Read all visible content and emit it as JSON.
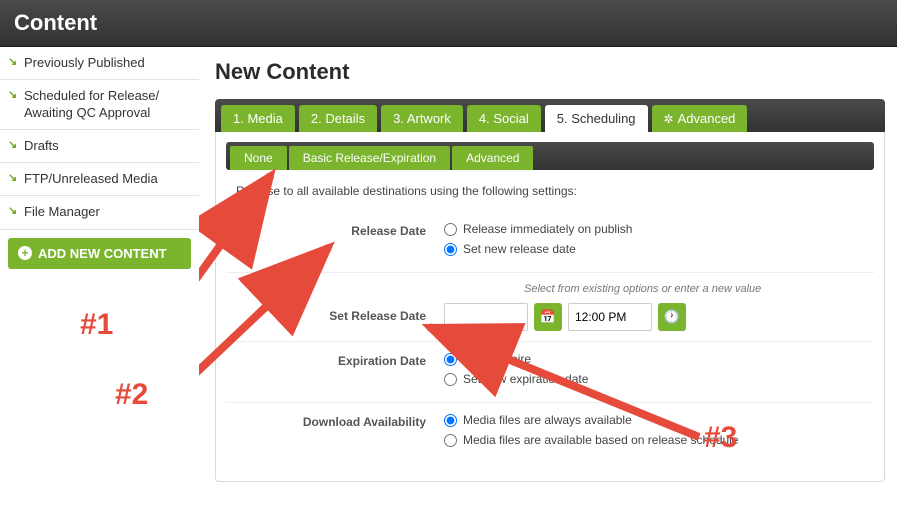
{
  "header": {
    "title": "Content"
  },
  "sidebar": {
    "items": [
      {
        "label": "Previously Published"
      },
      {
        "label": "Scheduled for Release/ Awaiting QC Approval"
      },
      {
        "label": "Drafts"
      },
      {
        "label": "FTP/Unreleased Media"
      },
      {
        "label": "File Manager"
      }
    ],
    "add_button": "ADD NEW CONTENT"
  },
  "page": {
    "title": "New Content"
  },
  "tabs": [
    {
      "label": "1. Media"
    },
    {
      "label": "2. Details"
    },
    {
      "label": "3. Artwork"
    },
    {
      "label": "4. Social"
    },
    {
      "label": "5. Scheduling"
    },
    {
      "label": "Advanced"
    }
  ],
  "subtabs": [
    {
      "label": "None"
    },
    {
      "label": "Basic Release/Expiration"
    },
    {
      "label": "Advanced"
    }
  ],
  "intro": "Release to all available destinations using the following settings:",
  "form": {
    "release_date": {
      "label": "Release Date",
      "opt_immediate": "Release immediately on publish",
      "opt_setnew": "Set new release date"
    },
    "set_release_date": {
      "label": "Set Release Date",
      "hint": "Select from existing options or enter a new value",
      "date_value": "",
      "time_value": "12:00 PM"
    },
    "expiration": {
      "label": "Expiration Date",
      "opt_never": "Never expire",
      "opt_setnew": "Set new expiration date"
    },
    "download": {
      "label": "Download Availability",
      "opt_always": "Media files are always available",
      "opt_schedule": "Media files are available based on release schedule"
    }
  },
  "annotations": {
    "l1": "#1",
    "l2": "#2",
    "l3": "#3"
  },
  "colors": {
    "accent": "#7bb42d",
    "arrow": "#e64a3b"
  }
}
